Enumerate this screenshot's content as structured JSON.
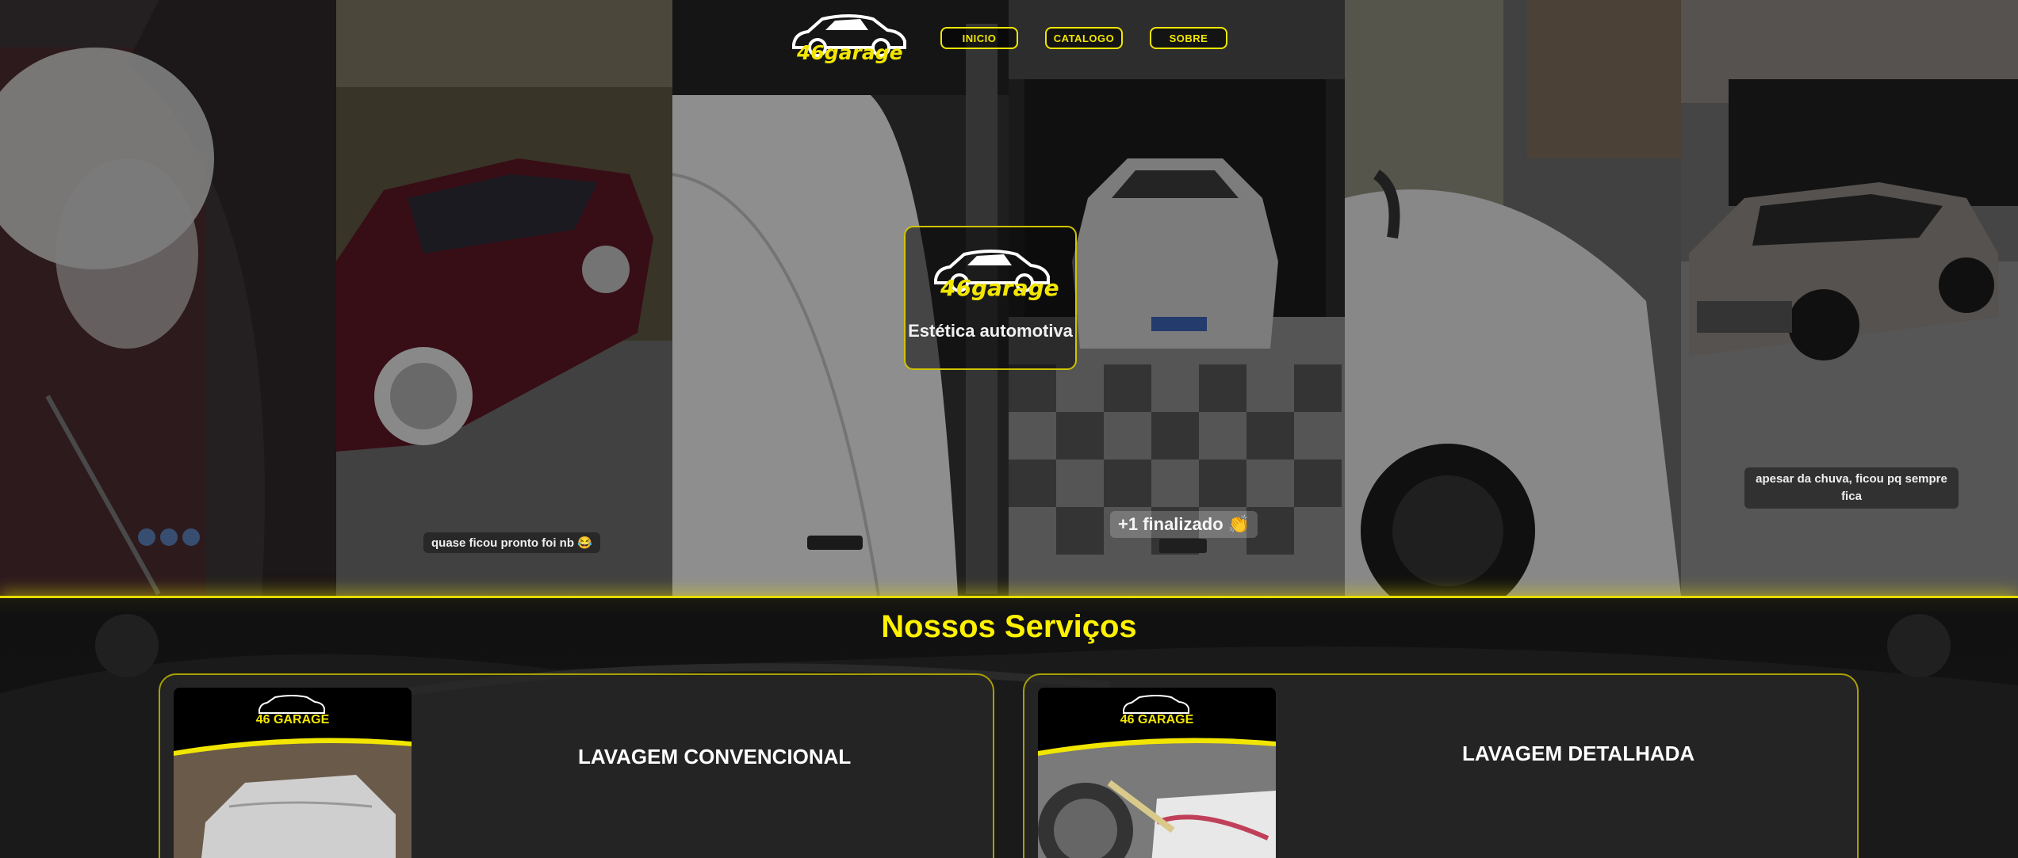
{
  "brand": {
    "logo_text": "46garage",
    "tagline": "Estética automotiva"
  },
  "nav": {
    "items": [
      {
        "label": "INICIO"
      },
      {
        "label": "CATALOGO"
      },
      {
        "label": "SOBRE"
      }
    ]
  },
  "hero": {
    "captions": [
      "quase ficou pronto foi nb 😂",
      "+1 finalizado 👏",
      "apesar da chuva, ficou pq sempre fica"
    ]
  },
  "services": {
    "title": "Nossos Serviços",
    "cards": [
      {
        "name": "LAVAGEM CONVENCIONAL",
        "thumb_brand": "46 GARAGE"
      },
      {
        "name": "LAVAGEM DETALHADA",
        "thumb_brand": "46 GARAGE"
      }
    ]
  },
  "colors": {
    "accent": "#f2e600",
    "background": "#0f0f0f"
  }
}
